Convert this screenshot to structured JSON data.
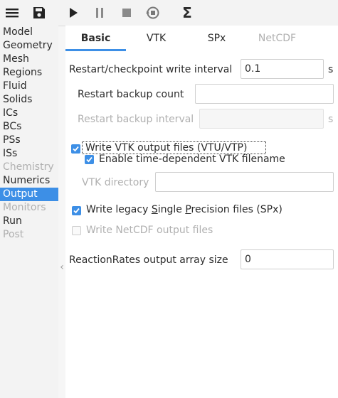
{
  "toolbar": {
    "icons": [
      "menu-icon",
      "save-icon",
      "play-icon",
      "pause-icon",
      "stop-icon",
      "reset-icon",
      "sigma-icon"
    ],
    "sigma_glyph": "Σ"
  },
  "sidebar": {
    "items": [
      {
        "label": "Model",
        "state": "normal"
      },
      {
        "label": "Geometry",
        "state": "normal"
      },
      {
        "label": "Mesh",
        "state": "normal"
      },
      {
        "label": "Regions",
        "state": "normal"
      },
      {
        "label": "Fluid",
        "state": "normal"
      },
      {
        "label": "Solids",
        "state": "normal"
      },
      {
        "label": "ICs",
        "state": "normal"
      },
      {
        "label": "BCs",
        "state": "normal"
      },
      {
        "label": "PSs",
        "state": "normal"
      },
      {
        "label": "ISs",
        "state": "normal"
      },
      {
        "label": "Chemistry",
        "state": "disabled"
      },
      {
        "label": "Numerics",
        "state": "normal"
      },
      {
        "label": "Output",
        "state": "active"
      },
      {
        "label": "Monitors",
        "state": "disabled"
      },
      {
        "label": "Run",
        "state": "normal"
      },
      {
        "label": "Post",
        "state": "disabled"
      }
    ],
    "collapse_glyph": "‹"
  },
  "tabs": [
    {
      "label": "Basic",
      "state": "active"
    },
    {
      "label": "VTK",
      "state": "normal"
    },
    {
      "label": "SPx",
      "state": "normal"
    },
    {
      "label": "NetCDF",
      "state": "disabled"
    }
  ],
  "form": {
    "restart_interval": {
      "label": "Restart/checkpoint write interval",
      "value": "0.1",
      "unit": "s"
    },
    "restart_backup_count": {
      "label": "Restart backup count",
      "value": ""
    },
    "restart_backup_interval": {
      "label": "Restart backup interval",
      "value": "",
      "unit": "s"
    },
    "write_vtk": {
      "label": "Write VTK output files (VTU/VTP)",
      "checked": true
    },
    "time_dependent_vtk": {
      "label": "Enable time-dependent VTK filename",
      "checked": true
    },
    "vtk_directory": {
      "label": "VTK directory",
      "value": ""
    },
    "write_spx": {
      "label_before_s": "Write legacy ",
      "label_s": "S",
      "label_mid": "ingle ",
      "label_p": "P",
      "label_after": "recision files (SPx)",
      "checked": true
    },
    "write_netcdf": {
      "label": "Write NetCDF output files",
      "checked": false
    },
    "reaction_rates": {
      "label": "ReactionRates output array size",
      "value": "0"
    }
  },
  "colors": {
    "accent": "#3d8fe6",
    "disabled": "#b0b0b0"
  }
}
